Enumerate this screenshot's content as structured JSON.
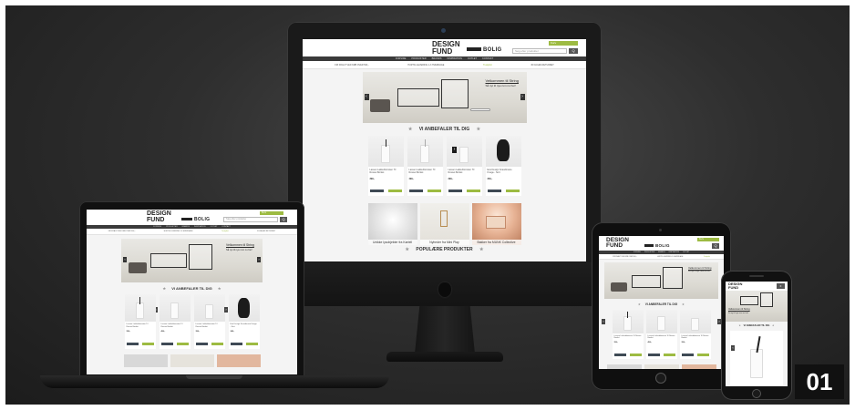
{
  "site": {
    "logo_top": "DESIGN",
    "logo_bottom": "FUND",
    "bolig": "BOLIG",
    "search_placeholder": "Søg efter produkter",
    "search_button": "Q",
    "cart_label": "Kurv",
    "nav": [
      "FORSIDE",
      "PRODUKTER",
      "BRANDS",
      "INSPIRATION",
      "OUTLET",
      "KONTAKT"
    ],
    "usp": [
      "FRI FRAGT VED KØB OVER 500,-",
      "HURTIG LEVERING 1-3 HVERDAGE",
      "30 DAGES RETURRET"
    ],
    "trustpilot": "Trustpilot",
    "hero_title": "Velkommen til String",
    "hero_sub": "Så nyt til nye rum nu her!",
    "hero_prev": "‹",
    "hero_next": "›",
    "section_recommend": "VI ANBEFALER TIL DIG",
    "section_popular": "POPULÆRE PRODUKTER",
    "star": "★",
    "products": [
      {
        "name": "Lassen Lakkeblomsten Til Rosset Bordet",
        "price": "399,-"
      },
      {
        "name": "Lassen Lakkeblomsten Til Rosset Bordet",
        "price": "499,-"
      },
      {
        "name": "Lassen Lakkeblomsten Til Rosset Bordet",
        "price": "399,-"
      },
      {
        "name": "Eva Design Scandinavie Knage - Sort",
        "price": "349,-"
      }
    ],
    "tiles": [
      "Unikke lysobjekter fra Kartell",
      "Nyheder fra Mini Play",
      "Bakker fra MUNK Collective"
    ]
  },
  "badge": "01",
  "colors": {
    "accent": "#9dbb42",
    "nav": "#3a3a3a",
    "background": "#2e2e2e"
  }
}
